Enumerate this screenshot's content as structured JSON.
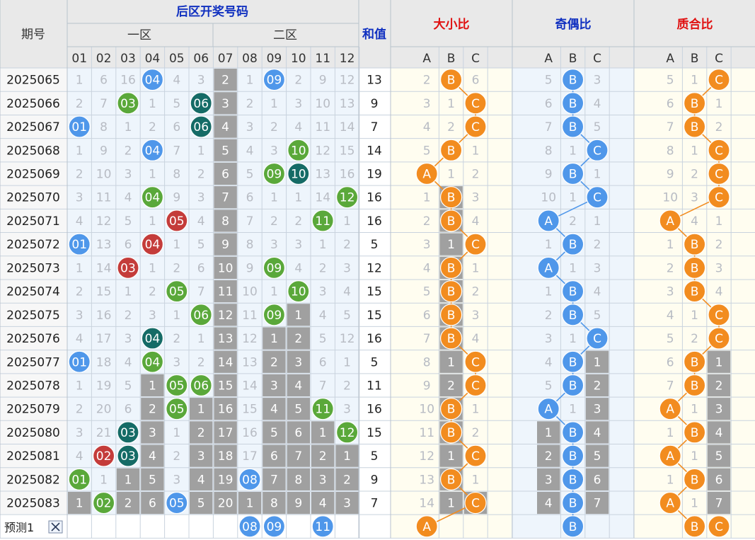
{
  "header": {
    "period_label": "期号",
    "back_area_title": "后区开奖号码",
    "zone1_label": "一区",
    "zone2_label": "二区",
    "sum_label": "和值",
    "size_ratio_title": "大小比",
    "odd_even_title": "奇偶比",
    "prime_title": "质合比",
    "number_headers": [
      "01",
      "02",
      "03",
      "04",
      "05",
      "06",
      "07",
      "08",
      "09",
      "10",
      "11",
      "12"
    ],
    "abc_headers": [
      "A",
      "B",
      "C"
    ]
  },
  "chart_data": {
    "type": "table",
    "rows": [
      {
        "period": "2025065",
        "cells": [
          "1",
          "6",
          "16",
          "04",
          "4",
          "3",
          "2",
          "1",
          "09",
          "2",
          "9",
          "12"
        ],
        "sum": "13",
        "size": [
          "2",
          "B",
          "6"
        ],
        "oe": [
          "5",
          "B",
          "3"
        ],
        "pc": [
          "5",
          "1",
          "C"
        ]
      },
      {
        "period": "2025066",
        "cells": [
          "2",
          "7",
          "03",
          "1",
          "5",
          "06",
          "3",
          "2",
          "1",
          "3",
          "10",
          "13"
        ],
        "sum": "9",
        "size": [
          "3",
          "1",
          "C"
        ],
        "oe": [
          "6",
          "B",
          "4"
        ],
        "pc": [
          "6",
          "B",
          "1"
        ]
      },
      {
        "period": "2025067",
        "cells": [
          "01",
          "8",
          "1",
          "2",
          "6",
          "06",
          "4",
          "3",
          "2",
          "4",
          "11",
          "14"
        ],
        "sum": "7",
        "size": [
          "4",
          "2",
          "C"
        ],
        "oe": [
          "7",
          "B",
          "5"
        ],
        "pc": [
          "7",
          "B",
          "2"
        ]
      },
      {
        "period": "2025068",
        "cells": [
          "1",
          "9",
          "2",
          "04",
          "7",
          "1",
          "5",
          "4",
          "3",
          "10",
          "12",
          "15"
        ],
        "sum": "14",
        "size": [
          "5",
          "B",
          "1"
        ],
        "oe": [
          "8",
          "1",
          "C"
        ],
        "pc": [
          "8",
          "1",
          "C"
        ]
      },
      {
        "period": "2025069",
        "cells": [
          "2",
          "10",
          "3",
          "1",
          "8",
          "2",
          "6",
          "5",
          "09",
          "10",
          "13",
          "16"
        ],
        "sum": "19",
        "size": [
          "A",
          "1",
          "2"
        ],
        "oe": [
          "9",
          "B",
          "1"
        ],
        "pc": [
          "9",
          "2",
          "C"
        ]
      },
      {
        "period": "2025070",
        "cells": [
          "3",
          "11",
          "4",
          "04",
          "9",
          "3",
          "7",
          "6",
          "1",
          "1",
          "14",
          "12"
        ],
        "sum": "16",
        "size": [
          "1",
          "B",
          "3"
        ],
        "oe": [
          "10",
          "1",
          "C"
        ],
        "pc": [
          "10",
          "3",
          "C"
        ]
      },
      {
        "period": "2025071",
        "cells": [
          "4",
          "12",
          "5",
          "1",
          "05",
          "4",
          "8",
          "7",
          "2",
          "2",
          "11",
          "1"
        ],
        "sum": "16",
        "size": [
          "2",
          "B",
          "4"
        ],
        "oe": [
          "A",
          "2",
          "1"
        ],
        "pc": [
          "A",
          "4",
          "1"
        ]
      },
      {
        "period": "2025072",
        "cells": [
          "01",
          "13",
          "6",
          "04",
          "1",
          "5",
          "9",
          "8",
          "3",
          "3",
          "1",
          "2"
        ],
        "sum": "5",
        "size": [
          "3",
          "1",
          "C"
        ],
        "oe": [
          "1",
          "B",
          "2"
        ],
        "pc": [
          "1",
          "B",
          "2"
        ]
      },
      {
        "period": "2025073",
        "cells": [
          "1",
          "14",
          "03",
          "1",
          "2",
          "6",
          "10",
          "9",
          "09",
          "4",
          "2",
          "3"
        ],
        "sum": "12",
        "size": [
          "4",
          "B",
          "1"
        ],
        "oe": [
          "A",
          "1",
          "3"
        ],
        "pc": [
          "2",
          "B",
          "3"
        ]
      },
      {
        "period": "2025074",
        "cells": [
          "2",
          "15",
          "1",
          "2",
          "05",
          "7",
          "11",
          "10",
          "1",
          "10",
          "3",
          "4"
        ],
        "sum": "15",
        "size": [
          "5",
          "B",
          "2"
        ],
        "oe": [
          "1",
          "B",
          "4"
        ],
        "pc": [
          "3",
          "B",
          "4"
        ]
      },
      {
        "period": "2025075",
        "cells": [
          "3",
          "16",
          "2",
          "3",
          "1",
          "06",
          "12",
          "11",
          "09",
          "1",
          "4",
          "5"
        ],
        "sum": "15",
        "size": [
          "6",
          "B",
          "3"
        ],
        "oe": [
          "2",
          "B",
          "5"
        ],
        "pc": [
          "4",
          "1",
          "C"
        ]
      },
      {
        "period": "2025076",
        "cells": [
          "4",
          "17",
          "3",
          "04",
          "2",
          "1",
          "13",
          "12",
          "1",
          "2",
          "5",
          "12"
        ],
        "sum": "16",
        "size": [
          "7",
          "B",
          "4"
        ],
        "oe": [
          "3",
          "1",
          "C"
        ],
        "pc": [
          "5",
          "2",
          "C"
        ]
      },
      {
        "period": "2025077",
        "cells": [
          "01",
          "18",
          "4",
          "04",
          "3",
          "2",
          "14",
          "13",
          "2",
          "3",
          "6",
          "1"
        ],
        "sum": "5",
        "size": [
          "8",
          "1",
          "C"
        ],
        "oe": [
          "4",
          "B",
          "1"
        ],
        "pc": [
          "6",
          "B",
          "1"
        ]
      },
      {
        "period": "2025078",
        "cells": [
          "1",
          "19",
          "5",
          "1",
          "05",
          "06",
          "15",
          "14",
          "3",
          "4",
          "7",
          "2"
        ],
        "sum": "11",
        "size": [
          "9",
          "2",
          "C"
        ],
        "oe": [
          "5",
          "B",
          "2"
        ],
        "pc": [
          "7",
          "B",
          "2"
        ]
      },
      {
        "period": "2025079",
        "cells": [
          "2",
          "20",
          "6",
          "2",
          "05",
          "1",
          "16",
          "15",
          "4",
          "5",
          "11",
          "3"
        ],
        "sum": "16",
        "size": [
          "10",
          "B",
          "1"
        ],
        "oe": [
          "A",
          "1",
          "3"
        ],
        "pc": [
          "A",
          "1",
          "3"
        ]
      },
      {
        "period": "2025080",
        "cells": [
          "3",
          "21",
          "03",
          "3",
          "1",
          "2",
          "17",
          "16",
          "5",
          "6",
          "1",
          "12"
        ],
        "sum": "15",
        "size": [
          "11",
          "B",
          "2"
        ],
        "oe": [
          "1",
          "B",
          "4"
        ],
        "pc": [
          "1",
          "B",
          "4"
        ]
      },
      {
        "period": "2025081",
        "cells": [
          "4",
          "02",
          "03",
          "4",
          "2",
          "3",
          "18",
          "17",
          "6",
          "7",
          "2",
          "1"
        ],
        "sum": "5",
        "size": [
          "12",
          "1",
          "C"
        ],
        "oe": [
          "2",
          "B",
          "5"
        ],
        "pc": [
          "A",
          "1",
          "5"
        ]
      },
      {
        "period": "2025082",
        "cells": [
          "01",
          "1",
          "1",
          "5",
          "3",
          "4",
          "19",
          "08",
          "7",
          "8",
          "3",
          "2"
        ],
        "sum": "9",
        "size": [
          "13",
          "B",
          "1"
        ],
        "oe": [
          "3",
          "B",
          "6"
        ],
        "pc": [
          "1",
          "B",
          "6"
        ]
      },
      {
        "period": "2025083",
        "cells": [
          "1",
          "02",
          "2",
          "6",
          "05",
          "5",
          "20",
          "1",
          "8",
          "9",
          "4",
          "3"
        ],
        "sum": "7",
        "size": [
          "14",
          "1",
          "C"
        ],
        "oe": [
          "4",
          "B",
          "7"
        ],
        "pc": [
          "A",
          "1",
          "7"
        ]
      }
    ],
    "grey_cells": [
      [
        0,
        6
      ],
      [
        1,
        6
      ],
      [
        2,
        6
      ],
      [
        3,
        6
      ],
      [
        4,
        6
      ],
      [
        5,
        6
      ],
      [
        6,
        6
      ],
      [
        7,
        6
      ],
      [
        8,
        6
      ],
      [
        9,
        6
      ],
      [
        10,
        6
      ],
      [
        11,
        6
      ],
      [
        12,
        6
      ],
      [
        13,
        6
      ],
      [
        14,
        6
      ],
      [
        15,
        6
      ],
      [
        16,
        6
      ],
      [
        17,
        6
      ],
      [
        18,
        6
      ],
      [
        10,
        9
      ],
      [
        11,
        8
      ],
      [
        11,
        9
      ],
      [
        12,
        8
      ],
      [
        12,
        9
      ],
      [
        13,
        3
      ],
      [
        13,
        8
      ],
      [
        13,
        9
      ],
      [
        14,
        3
      ],
      [
        14,
        5
      ],
      [
        14,
        8
      ],
      [
        14,
        9
      ],
      [
        15,
        3
      ],
      [
        15,
        5
      ],
      [
        15,
        8
      ],
      [
        15,
        9
      ],
      [
        15,
        10
      ],
      [
        16,
        3
      ],
      [
        16,
        5
      ],
      [
        16,
        8
      ],
      [
        16,
        9
      ],
      [
        16,
        10
      ],
      [
        16,
        11
      ],
      [
        17,
        2
      ],
      [
        17,
        3
      ],
      [
        17,
        5
      ],
      [
        17,
        8
      ],
      [
        17,
        9
      ],
      [
        17,
        10
      ],
      [
        17,
        11
      ],
      [
        18,
        0
      ],
      [
        18,
        2
      ],
      [
        18,
        3
      ],
      [
        18,
        5
      ],
      [
        18,
        7
      ],
      [
        18,
        8
      ],
      [
        18,
        9
      ],
      [
        18,
        10
      ],
      [
        18,
        11
      ],
      [
        5,
        13
      ],
      [
        6,
        13
      ],
      [
        7,
        13
      ],
      [
        8,
        13
      ],
      [
        9,
        13
      ],
      [
        10,
        13
      ],
      [
        11,
        13
      ],
      [
        12,
        13
      ],
      [
        13,
        13
      ],
      [
        14,
        13
      ],
      [
        15,
        13
      ],
      [
        16,
        13
      ],
      [
        17,
        13
      ],
      [
        18,
        13
      ],
      [
        18,
        14
      ],
      [
        12,
        18
      ],
      [
        13,
        18
      ],
      [
        14,
        18
      ],
      [
        15,
        18
      ],
      [
        16,
        18
      ],
      [
        17,
        18
      ],
      [
        18,
        18
      ],
      [
        15,
        16
      ],
      [
        16,
        16
      ],
      [
        17,
        16
      ],
      [
        18,
        16
      ],
      [
        12,
        22
      ],
      [
        13,
        22
      ],
      [
        14,
        22
      ],
      [
        15,
        22
      ],
      [
        16,
        22
      ],
      [
        17,
        22
      ],
      [
        18,
        22
      ]
    ],
    "prediction": {
      "label": "预测1",
      "numbers": [
        "08",
        "09",
        "11"
      ],
      "size": [
        "A",
        "",
        ""
      ],
      "oe": [
        "",
        "B",
        ""
      ],
      "pc": [
        "",
        "B",
        "C"
      ]
    }
  },
  "colors": {
    "blue": "#4f97ea",
    "green": "#5aa83a",
    "teal": "#156b66",
    "red": "#c43c3a",
    "orange": "#f28c1f",
    "grey": "#a0a0a0"
  }
}
